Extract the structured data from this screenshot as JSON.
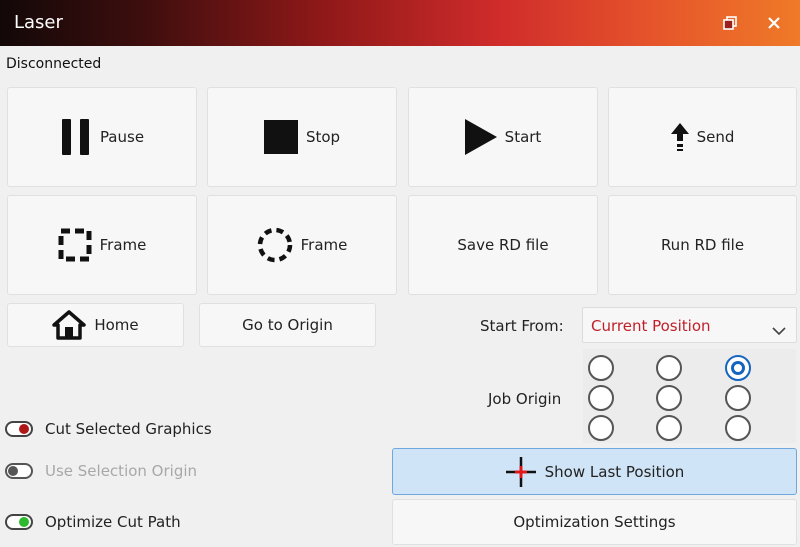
{
  "window": {
    "title": "Laser"
  },
  "status": "Disconnected",
  "buttons": {
    "pause": "Pause",
    "stop": "Stop",
    "start": "Start",
    "send": "Send",
    "frame_rect": "Frame",
    "frame_circle": "Frame",
    "save_rd": "Save RD file",
    "run_rd": "Run RD file",
    "home": "Home",
    "go_to_origin": "Go to Origin",
    "show_last_position": "Show Last Position",
    "optimization_settings": "Optimization Settings"
  },
  "start_from": {
    "label": "Start From:",
    "value": "Current Position"
  },
  "job_origin": {
    "label": "Job Origin",
    "selected_index": 2
  },
  "options": {
    "cut_selected": {
      "label": "Cut Selected Graphics",
      "on": true,
      "color": "#b01818"
    },
    "use_selection_origin": {
      "label": "Use Selection Origin",
      "on": false,
      "disabled": true
    },
    "optimize_cut_path": {
      "label": "Optimize Cut Path",
      "on": true,
      "color": "#2db82d"
    }
  },
  "colors": {
    "accent_red": "#c0202a",
    "selected_blue": "#1565c0"
  }
}
